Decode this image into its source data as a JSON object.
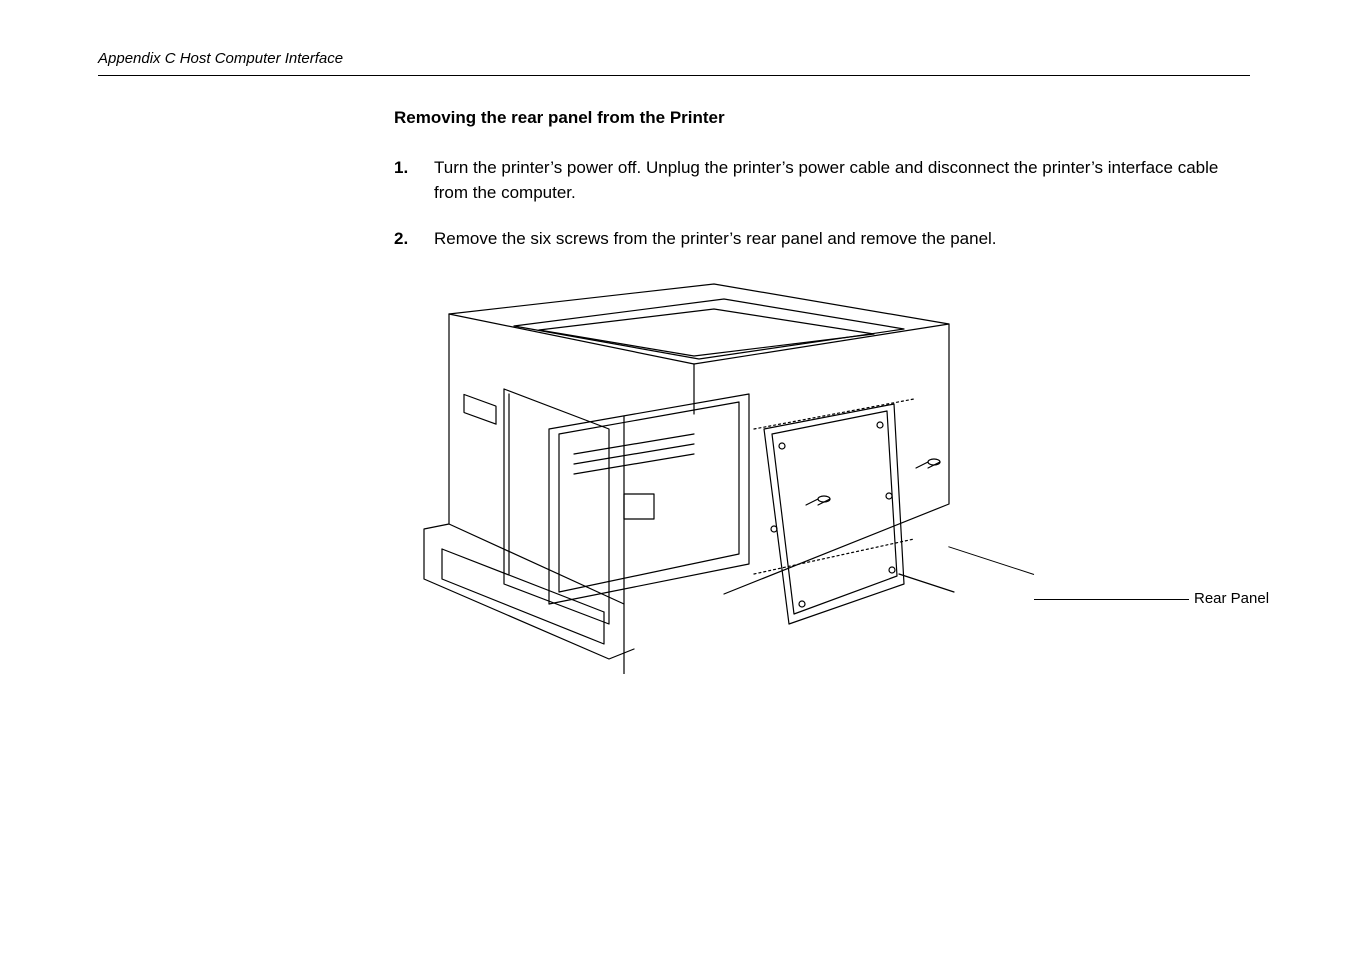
{
  "header": {
    "running": "Appendix C  Host Computer Interface"
  },
  "section": {
    "title": "Removing the rear panel from the Printer"
  },
  "steps": [
    {
      "num": "1.",
      "text": "Turn the printer’s power off. Unplug the printer’s power cable and disconnect the printer’s interface cable from the computer."
    },
    {
      "num": "2.",
      "text": "Remove the six screws from the printer’s rear panel and remove the panel."
    }
  ],
  "figure": {
    "callout": "Rear Panel"
  }
}
